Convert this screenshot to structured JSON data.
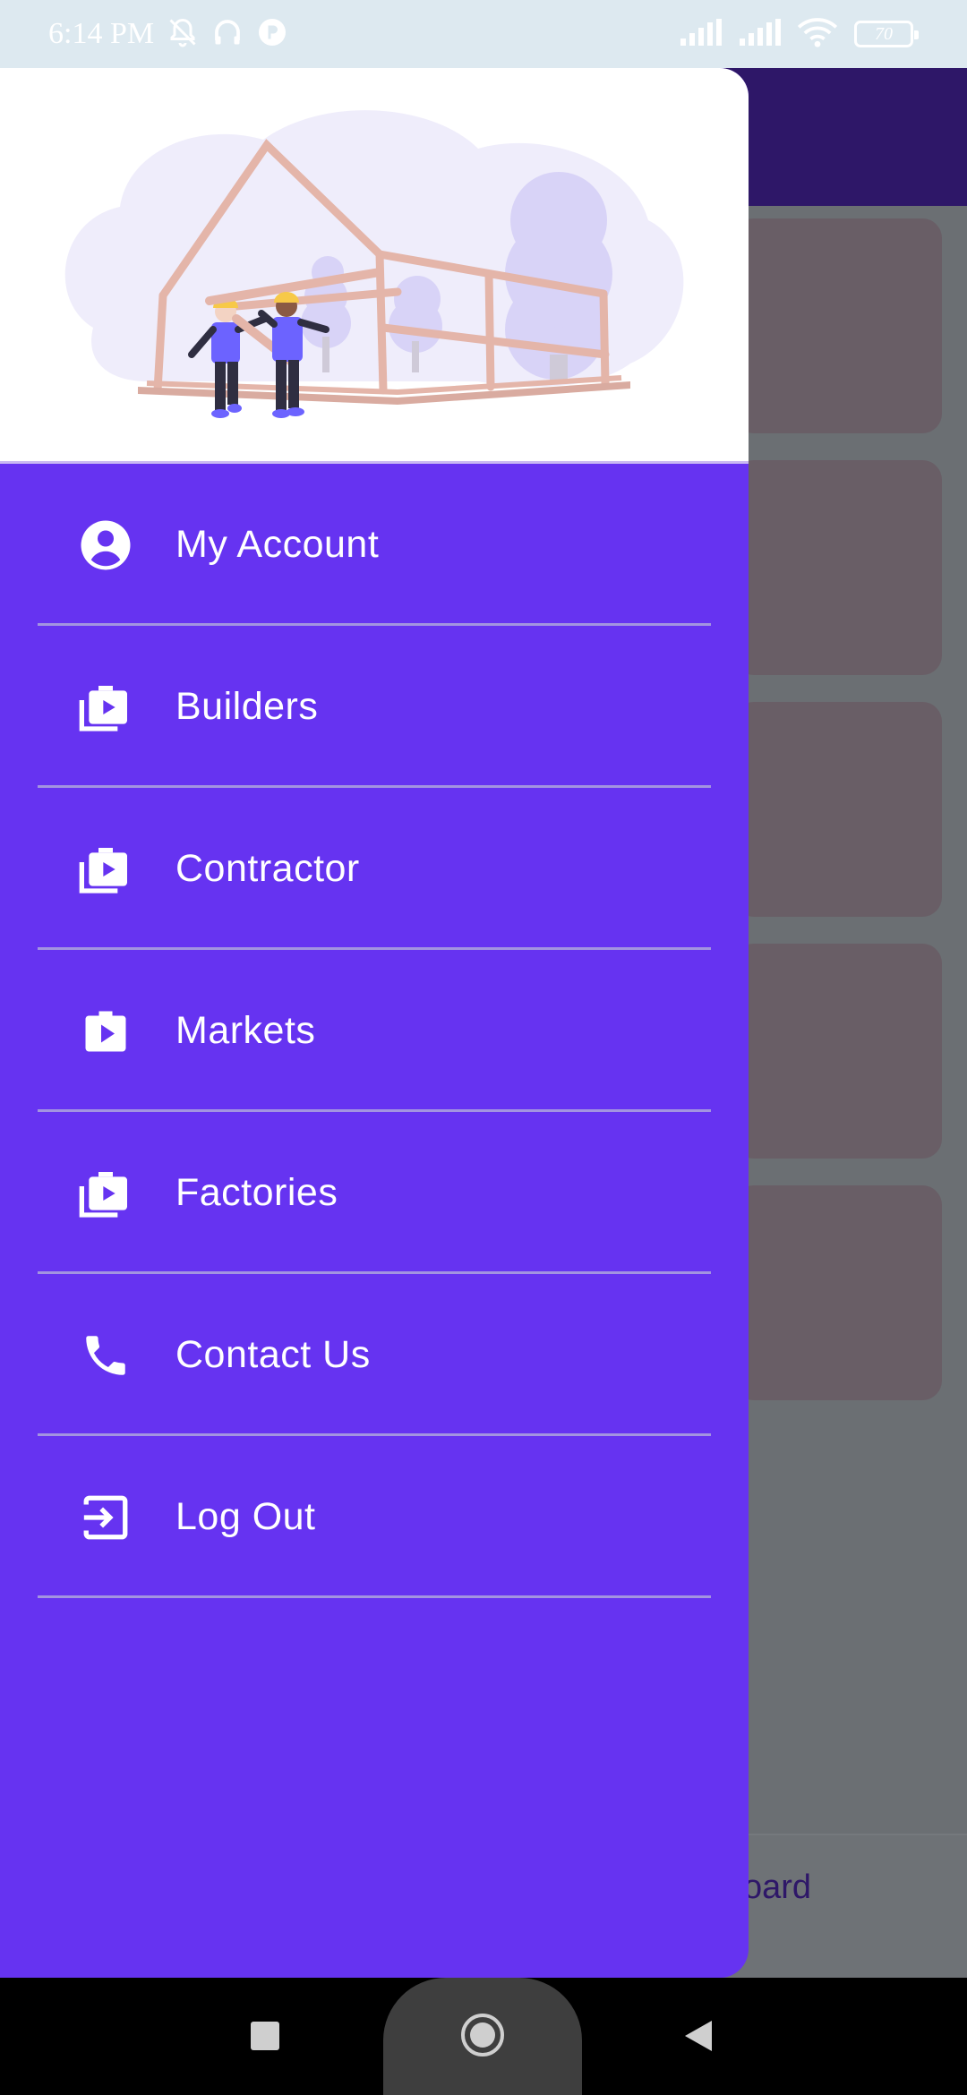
{
  "status_bar": {
    "time": "6:14 PM",
    "battery_level": "70",
    "icons": [
      "bell-off-icon",
      "headphones-icon",
      "app-badge-icon",
      "signal-icon",
      "signal-icon",
      "wifi-icon",
      "battery-icon"
    ]
  },
  "drawer": {
    "header_illustration": "construction-workers-house-frame",
    "menu_items": [
      {
        "label": "My Account",
        "icon": "account-circle-icon"
      },
      {
        "label": "Builders",
        "icon": "work-history-icon"
      },
      {
        "label": "Contractor",
        "icon": "work-history-icon"
      },
      {
        "label": "Markets",
        "icon": "work-play-icon"
      },
      {
        "label": "Factories",
        "icon": "work-history-icon"
      },
      {
        "label": "Contact Us",
        "icon": "phone-icon"
      },
      {
        "label": "Log Out",
        "icon": "logout-icon"
      }
    ]
  },
  "background": {
    "bottom_partial_text": "oard"
  },
  "colors": {
    "drawer_bg": "#6633f1",
    "header_bg": "#2e1768",
    "status_bar_bg": "#dde9f0",
    "scrim": "#6b6f73"
  },
  "nav_bar": {
    "buttons": [
      "recents-button",
      "home-button",
      "back-button"
    ]
  }
}
